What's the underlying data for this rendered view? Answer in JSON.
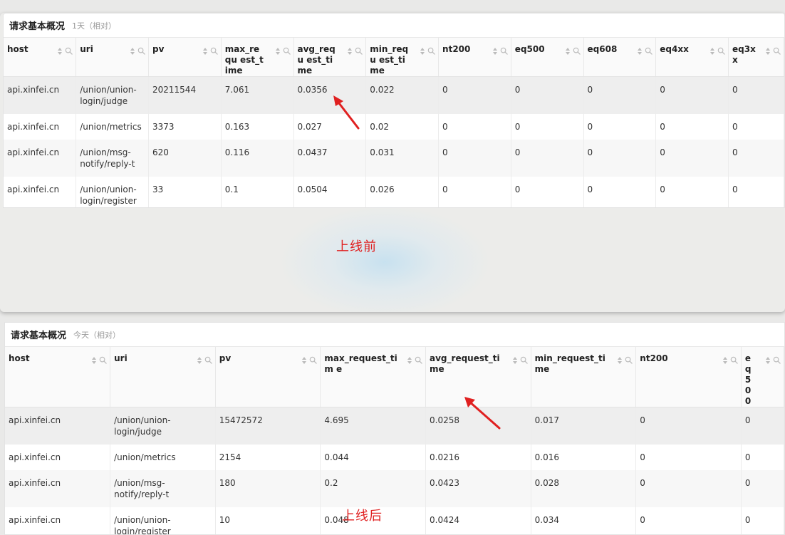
{
  "before": {
    "title": "请求基本概况",
    "subtitle": "1天（相对）",
    "columns": [
      "host",
      "uri",
      "pv",
      "max_requ est_time",
      "avg_requ est_time",
      "min_requ est_time",
      "nt200",
      "eq500",
      "eq608",
      "eq4xx",
      "eq3xx"
    ],
    "rows": [
      [
        "api.xinfei.cn",
        "/union/union-login/judge",
        "20211544",
        "7.061",
        "0.0356",
        "0.022",
        "0",
        "0",
        "0",
        "0",
        "0"
      ],
      [
        "api.xinfei.cn",
        "/union/metrics",
        "3373",
        "0.163",
        "0.027",
        "0.02",
        "0",
        "0",
        "0",
        "0",
        "0"
      ],
      [
        "api.xinfei.cn",
        "/union/msg-notify/reply-t",
        "620",
        "0.116",
        "0.0437",
        "0.031",
        "0",
        "0",
        "0",
        "0",
        "0"
      ],
      [
        "api.xinfei.cn",
        "/union/union-login/register",
        "33",
        "0.1",
        "0.0504",
        "0.026",
        "0",
        "0",
        "0",
        "0",
        "0"
      ]
    ],
    "caption": "上线前"
  },
  "after": {
    "title": "请求基本概况",
    "subtitle": "今天（相对）",
    "columns": [
      "host",
      "uri",
      "pv",
      "max_request_tim e",
      "avg_request_time",
      "min_request_time",
      "nt200",
      "eq500"
    ],
    "rows": [
      [
        "api.xinfei.cn",
        "/union/union-login/judge",
        "15472572",
        "4.695",
        "0.0258",
        "0.017",
        "0",
        "0"
      ],
      [
        "api.xinfei.cn",
        "/union/metrics",
        "2154",
        "0.044",
        "0.0216",
        "0.016",
        "0",
        "0"
      ],
      [
        "api.xinfei.cn",
        "/union/msg-notify/reply-t",
        "180",
        "0.2",
        "0.0423",
        "0.028",
        "0",
        "0"
      ],
      [
        "api.xinfei.cn",
        "/union/union-login/register",
        "10",
        "0.048",
        "0.0424",
        "0.034",
        "0",
        "0"
      ]
    ],
    "caption": "上线后"
  },
  "colors": {
    "arrow": "#e02020",
    "caption": "#e02020",
    "highlight_row": "#eeeeee"
  },
  "icons": {
    "sort": "sort-icon",
    "filter": "search-icon",
    "annotation": "arrow-icon"
  }
}
